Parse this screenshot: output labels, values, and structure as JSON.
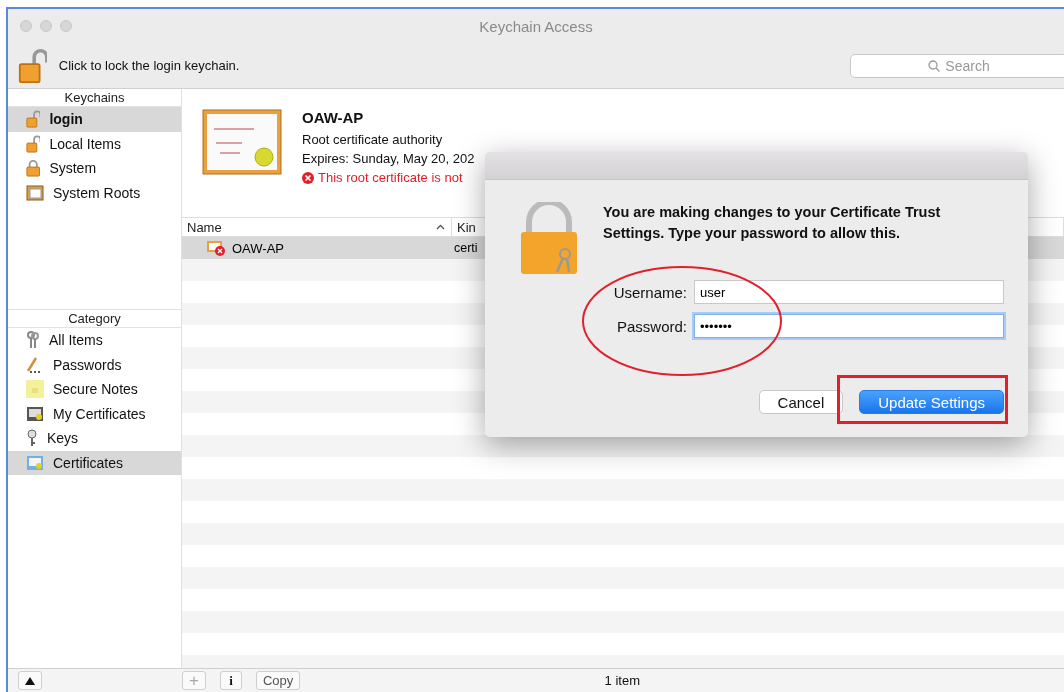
{
  "window": {
    "title": "Keychain Access"
  },
  "toolbar": {
    "lock_text": "Click to lock the login keychain.",
    "search": {
      "placeholder": "Search"
    }
  },
  "keychains": {
    "header": "Keychains",
    "items": [
      {
        "label": "login",
        "kind": "open-lock",
        "selected": true
      },
      {
        "label": "Local Items",
        "kind": "open-lock",
        "selected": false
      },
      {
        "label": "System",
        "kind": "lock",
        "selected": false
      },
      {
        "label": "System Roots",
        "kind": "cabinet",
        "selected": false
      }
    ]
  },
  "category": {
    "header": "Category",
    "items": [
      {
        "label": "All Items",
        "kind": "keys",
        "selected": false
      },
      {
        "label": "Passwords",
        "kind": "pencil",
        "selected": false
      },
      {
        "label": "Secure Notes",
        "kind": "note",
        "selected": false
      },
      {
        "label": "My Certificates",
        "kind": "dark-cert",
        "selected": false
      },
      {
        "label": "Keys",
        "kind": "key",
        "selected": false
      },
      {
        "label": "Certificates",
        "kind": "cert",
        "selected": true
      }
    ]
  },
  "certificate": {
    "name": "OAW-AP",
    "type": "Root certificate authority",
    "expires": "Expires: Sunday, May 20, 202",
    "warning": "This root certificate is not"
  },
  "table": {
    "columns": [
      "Name",
      "Kin"
    ],
    "rows": [
      {
        "cells": [
          "OAW-AP",
          "certi"
        ],
        "selected": true
      }
    ]
  },
  "bottom_bar": {
    "add": "+",
    "info": "i",
    "copy": "Copy",
    "count": "1 item"
  },
  "dialog": {
    "message": "You are making changes to your Certificate Trust Settings. Type your password to allow this.",
    "fields": [
      {
        "label": "Username:",
        "value": "user",
        "focused": false
      },
      {
        "label": "Password:",
        "value": "•••••••",
        "focused": true
      }
    ],
    "buttons": [
      {
        "label": "Cancel",
        "default": false
      },
      {
        "label": "Update Settings",
        "default": true
      }
    ]
  }
}
